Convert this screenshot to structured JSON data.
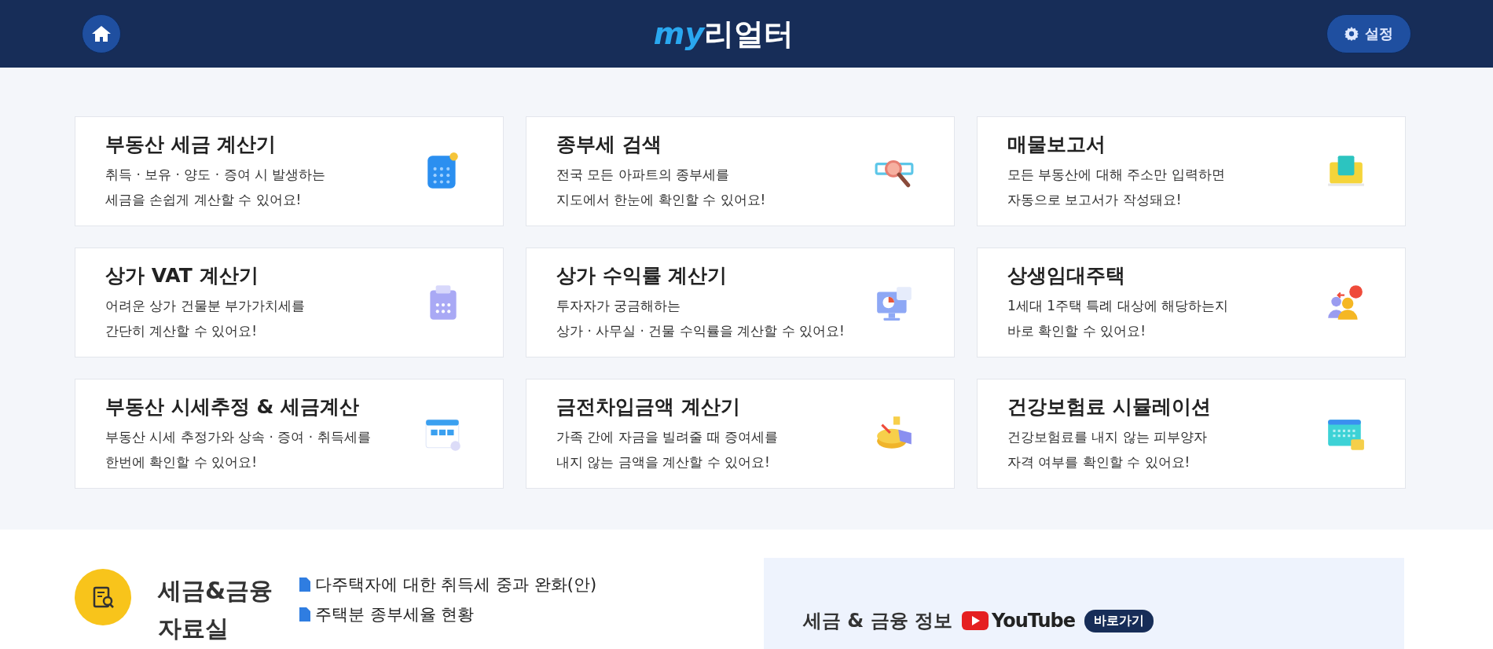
{
  "header": {
    "logo_prefix": "my",
    "logo_main": "리얼터",
    "settings_label": "설정"
  },
  "cards": [
    {
      "title": "부동산 세금 계산기",
      "lines": [
        "취득 · 보유 · 양도 · 증여 시 발생하는",
        "세금을 손쉽게 계산할 수 있어요!"
      ],
      "kind": "calculator"
    },
    {
      "title": "종부세 검색",
      "lines": [
        "전국 모든 아파트의 종부세를",
        "지도에서 한눈에 확인할 수 있어요!"
      ],
      "kind": "magnifier"
    },
    {
      "title": "매물보고서",
      "lines": [
        "모든 부동산에 대해 주소만 입력하면",
        "자동으로 보고서가 작성돼요!"
      ],
      "kind": "laptop"
    },
    {
      "title": "상가 VAT 계산기",
      "lines": [
        "어려운 상가 건물분 부가가치세를",
        "간단히 계산할 수 있어요!"
      ],
      "kind": "receipt"
    },
    {
      "title": "상가 수익률 계산기",
      "lines": [
        "투자자가 궁금해하는",
        "상가 · 사무실 · 건물 수익률을 계산할 수 있어요!"
      ],
      "kind": "monitor"
    },
    {
      "title": "상생임대주택",
      "lines": [
        "1세대 1주택 특례 대상에 해당하는지",
        "바로 확인할 수 있어요!"
      ],
      "kind": "people"
    },
    {
      "title": "부동산 시세추정 & 세금계산",
      "lines": [
        "부동산 시세 추정가와 상속 · 증여 · 취득세를",
        "한번에 확인할 수 있어요!"
      ],
      "kind": "browser"
    },
    {
      "title": "금전차입금액 계산기",
      "lines": [
        "가족 간에 자금을 빌려줄 때 증여세를",
        "내지 않는 금액을 계산할 수 있어요!"
      ],
      "kind": "pie"
    },
    {
      "title": "건강보험료 시뮬레이션",
      "lines": [
        "건강보험료를 내지 않는 피부양자",
        "자격 여부를 확인할 수 있어요!"
      ],
      "kind": "calendar"
    }
  ],
  "library": {
    "title_lines": [
      "세금&금융",
      "자료실"
    ],
    "documents": [
      "다주택자에 대한 취득세 중과 완화(안)",
      "주택분 종부세율 현황"
    ]
  },
  "banner": {
    "title": "세금 & 금융 정보",
    "brand": "YouTube",
    "link": "바로가기"
  }
}
